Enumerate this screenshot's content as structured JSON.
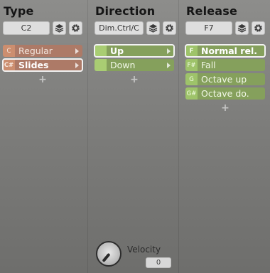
{
  "type": {
    "title": "Type",
    "selector_value": "C2",
    "items": [
      {
        "key": "C",
        "label": "Regular"
      },
      {
        "key": "C#",
        "label": "Slides"
      }
    ]
  },
  "direction": {
    "title": "Direction",
    "selector_value": "Dim.Ctrl/C",
    "items": [
      {
        "label": "Up"
      },
      {
        "label": "Down"
      }
    ]
  },
  "release": {
    "title": "Release",
    "selector_value": "F7",
    "items": [
      {
        "key": "F",
        "label": "Normal rel."
      },
      {
        "key": "F#",
        "label": "Fall"
      },
      {
        "key": "G",
        "label": "Octave up"
      },
      {
        "key": "G#",
        "label": "Octave do."
      }
    ]
  },
  "velocity": {
    "label": "Velocity",
    "value": "0"
  },
  "icons": {
    "layers": "layers-icon",
    "settings": "gear-icon",
    "add": "plus-icon",
    "expand": "arrow-right-icon"
  },
  "colors": {
    "type_accent": "#cc8e6f",
    "direction_accent": "#9ec36a",
    "release_accent": "#9ec36a"
  }
}
